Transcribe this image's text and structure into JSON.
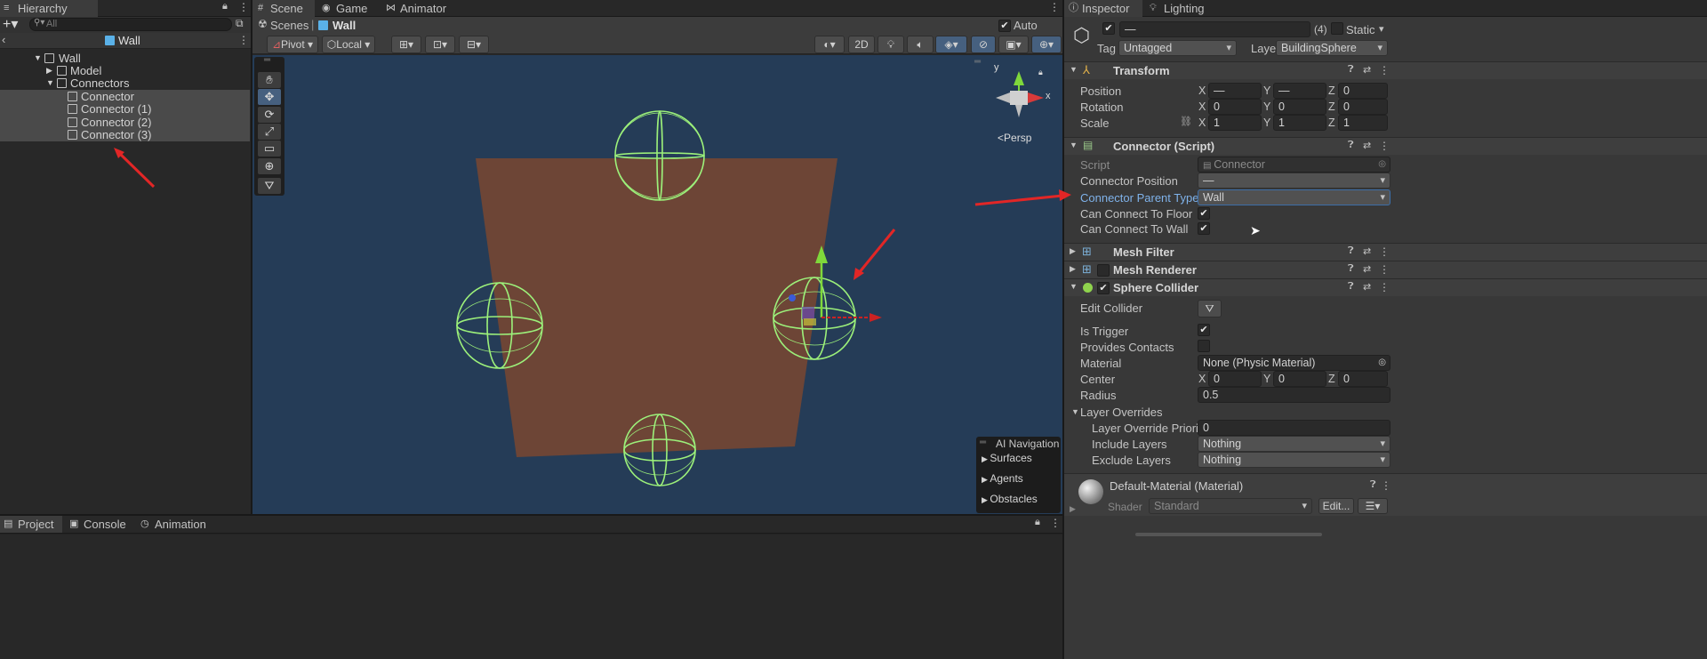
{
  "hierarchy": {
    "tab_label": "Hierarchy",
    "search_placeholder": "All",
    "root_label": "Wall",
    "items": [
      {
        "label": "Wall"
      },
      {
        "label": "Model"
      },
      {
        "label": "Connectors"
      },
      {
        "label": "Connector"
      },
      {
        "label": "Connector (1)"
      },
      {
        "label": "Connector (2)"
      },
      {
        "label": "Connector (3)"
      }
    ]
  },
  "scene": {
    "tabs": [
      {
        "label": "Scene"
      },
      {
        "label": "Game"
      },
      {
        "label": "Animator"
      }
    ],
    "breadcrumb_root": "Scenes",
    "breadcrumb_current": "Wall",
    "auto_save_label": "Auto Save",
    "auto_save_checked": true,
    "pivot_label": "Pivot",
    "local_label": "Local",
    "mode_2d_label": "2D",
    "persp_label": "Persp",
    "gizmo_axes": {
      "x": "x",
      "y": "y"
    },
    "ai_navigation": {
      "title": "AI Navigation",
      "items": [
        {
          "label": "Surfaces"
        },
        {
          "label": "Agents"
        },
        {
          "label": "Obstacles"
        }
      ]
    },
    "colors": {
      "sky": "#253c57",
      "wall": "#6d4536",
      "collider": "#9cf07a",
      "annotation_arrow": "#e22626"
    }
  },
  "inspector": {
    "tabs": [
      {
        "label": "Inspector"
      },
      {
        "label": "Lighting"
      }
    ],
    "object_name": "—",
    "multi_count": "(4)",
    "static_label": "Static",
    "tag_label": "Tag",
    "tag_value": "Untagged",
    "layer_label": "Layer",
    "layer_value": "BuildingSphere",
    "transform": {
      "title": "Transform",
      "position_label": "Position",
      "rotation_label": "Rotation",
      "scale_label": "Scale",
      "position": {
        "x": "—",
        "y": "—",
        "z": "0"
      },
      "rotation": {
        "x": "0",
        "y": "0",
        "z": "0"
      },
      "scale": {
        "x": "1",
        "y": "1",
        "z": "1"
      },
      "axis_x": "X",
      "axis_y": "Y",
      "axis_z": "Z"
    },
    "connector_script": {
      "title": "Connector (Script)",
      "script_label": "Script",
      "script_value": "Connector",
      "position_label": "Connector Position",
      "position_value": "—",
      "parent_type_label": "Connector Parent Type",
      "parent_type_value": "Wall",
      "floor_label": "Can Connect To Floor",
      "floor_checked": true,
      "wall_label": "Can Connect To Wall",
      "wall_checked": true
    },
    "mesh_filter_title": "Mesh Filter",
    "mesh_renderer_title": "Mesh Renderer",
    "sphere_collider": {
      "title": "Sphere Collider",
      "edit_collider_label": "Edit Collider",
      "is_trigger_label": "Is Trigger",
      "is_trigger_checked": true,
      "provides_contacts_label": "Provides Contacts",
      "provides_contacts_checked": false,
      "material_label": "Material",
      "material_value": "None (Physic Material)",
      "center_label": "Center",
      "center": {
        "x": "0",
        "y": "0",
        "z": "0"
      },
      "radius_label": "Radius",
      "radius_value": "0.5",
      "layer_overrides_label": "Layer Overrides",
      "layer_override_priority_label": "Layer Override Priority",
      "layer_override_priority_value": "0",
      "include_layers_label": "Include Layers",
      "include_layers_value": "Nothing",
      "exclude_layers_label": "Exclude Layers",
      "exclude_layers_value": "Nothing"
    },
    "material": {
      "title": "Default-Material (Material)",
      "shader_label": "Shader",
      "shader_value": "Standard",
      "edit_label": "Edit..."
    }
  },
  "bottom_tabs": [
    {
      "label": "Project"
    },
    {
      "label": "Console"
    },
    {
      "label": "Animation"
    }
  ]
}
